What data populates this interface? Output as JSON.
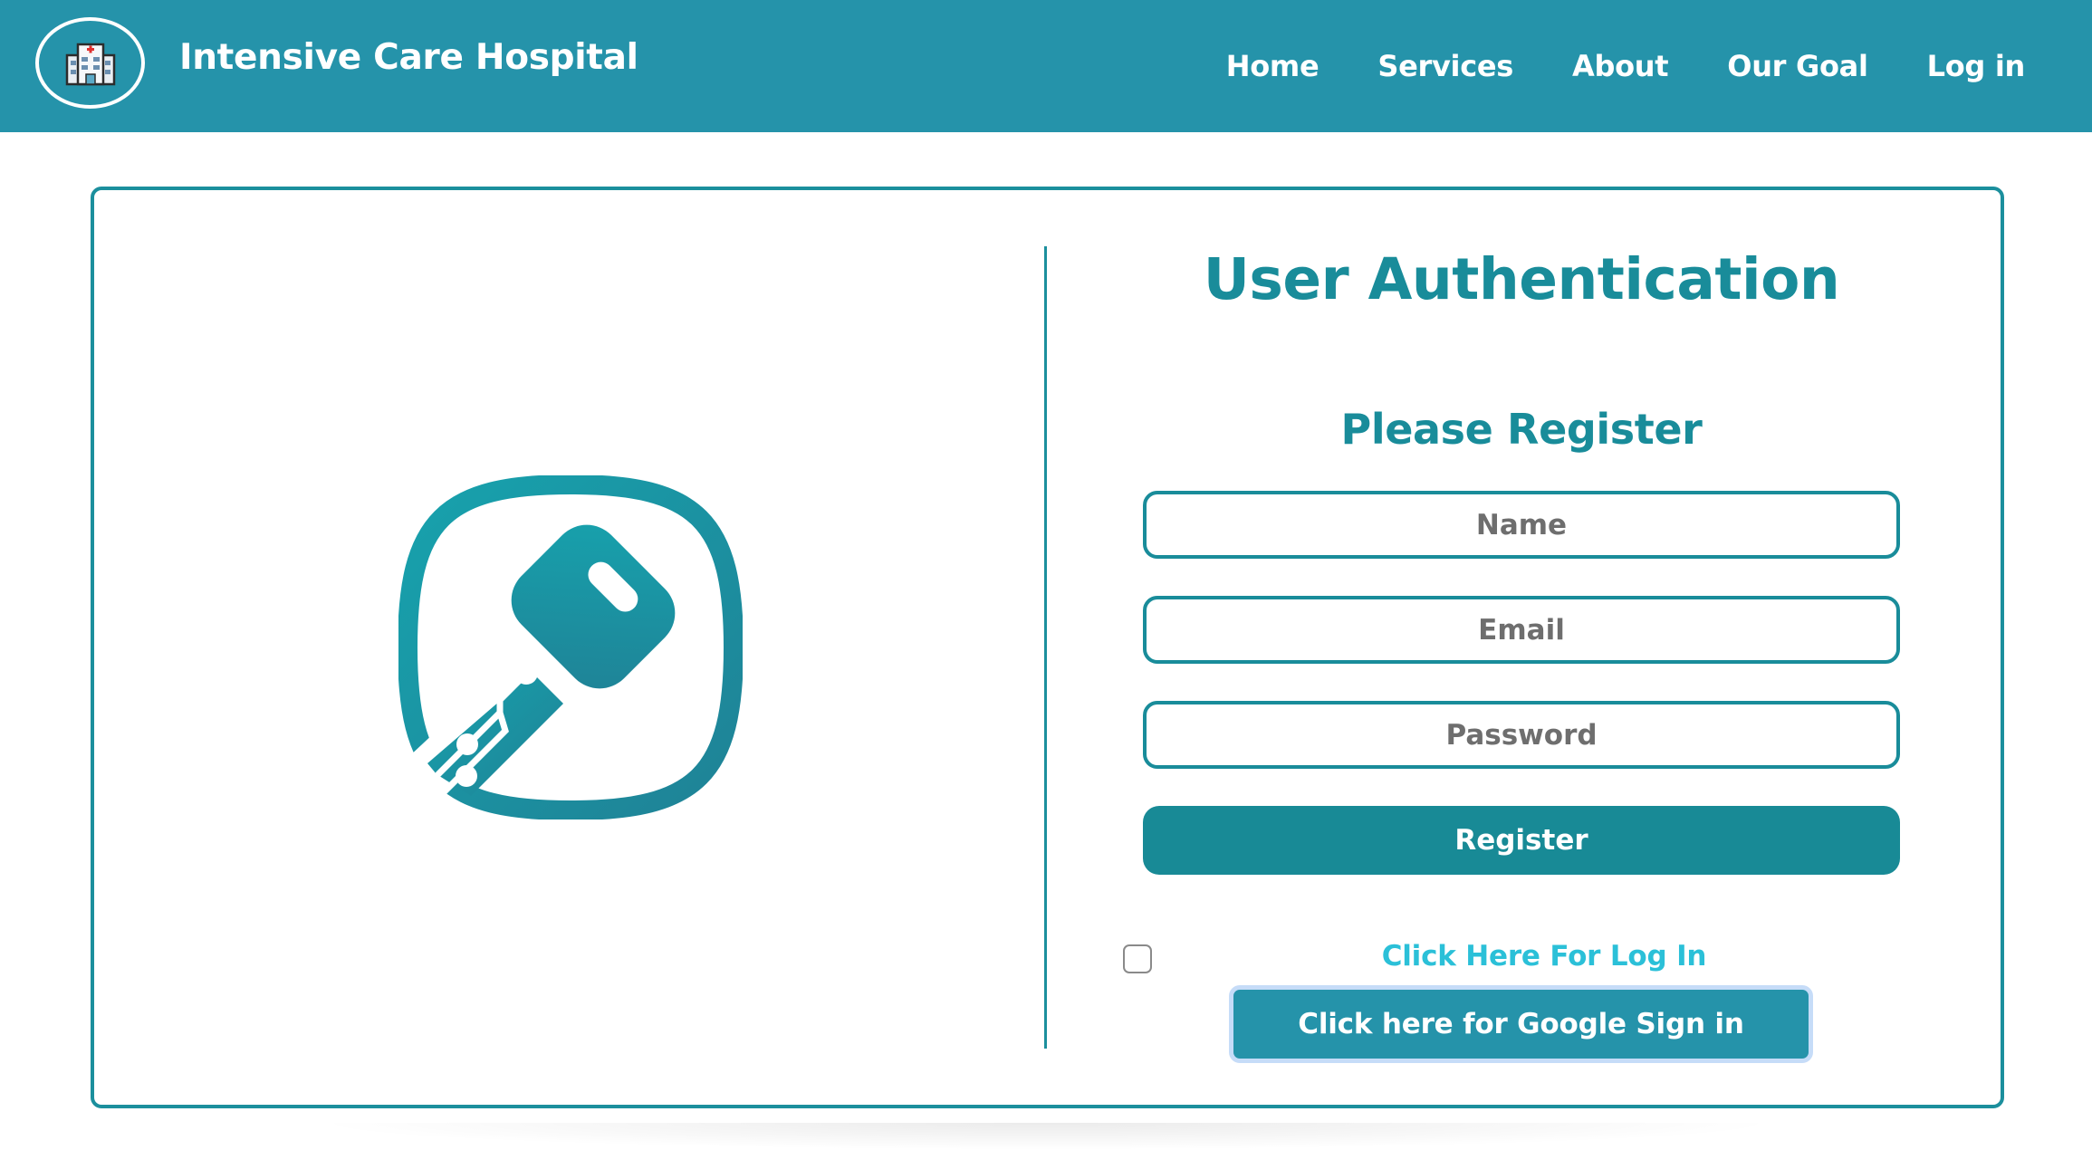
{
  "header": {
    "brand_title": "Intensive Care Hospital",
    "logo_icon": "hospital-icon",
    "nav": [
      {
        "label": "Home"
      },
      {
        "label": "Services"
      },
      {
        "label": "About"
      },
      {
        "label": "Our Goal"
      },
      {
        "label": "Log in"
      }
    ]
  },
  "illustration": {
    "icon": "digital-key-icon"
  },
  "auth": {
    "title": "User Authentication",
    "subtitle": "Please Register",
    "name_placeholder": "Name",
    "email_placeholder": "Email",
    "password_placeholder": "Password",
    "register_label": "Register",
    "login_link": "Click Here For Log In",
    "google_label": "Click here for Google Sign in"
  },
  "colors": {
    "brand": "#2593aa",
    "accent": "#198c9a",
    "link": "#2bc0d8"
  }
}
